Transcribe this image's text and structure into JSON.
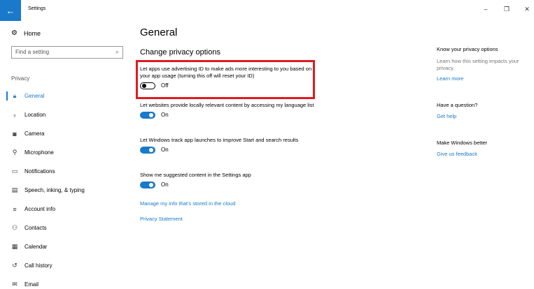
{
  "window": {
    "title": "Settings",
    "back_glyph": "←",
    "minimize_glyph": "–",
    "maximize_glyph": "❐",
    "close_glyph": "✕",
    "accent_color": "#1979ca",
    "highlight_color": "#e11b22"
  },
  "sidebar": {
    "home_label": "Home",
    "search_placeholder": "Find a setting",
    "section_label": "Privacy",
    "items": [
      {
        "label": "General",
        "icon": "lock-icon",
        "active": true
      },
      {
        "label": "Location",
        "icon": "location-icon"
      },
      {
        "label": "Camera",
        "icon": "camera-icon"
      },
      {
        "label": "Microphone",
        "icon": "microphone-icon"
      },
      {
        "label": "Notifications",
        "icon": "notifications-icon"
      },
      {
        "label": "Speech, inking, & typing",
        "icon": "speech-icon"
      },
      {
        "label": "Account info",
        "icon": "account-info-icon"
      },
      {
        "label": "Contacts",
        "icon": "contacts-icon"
      },
      {
        "label": "Calendar",
        "icon": "calendar-icon"
      },
      {
        "label": "Call history",
        "icon": "call-history-icon"
      },
      {
        "label": "Email",
        "icon": "email-icon"
      }
    ]
  },
  "main": {
    "title": "General",
    "subtitle": "Change privacy options",
    "settings": [
      {
        "text": "Let apps use advertising ID to make ads more interesting to you based on your app usage (turning this off will reset your ID)",
        "state": "Off"
      },
      {
        "text": "Let websites provide locally relevant content by accessing my language list",
        "state": "On"
      },
      {
        "text": "Let Windows track app launches to improve Start and search results",
        "state": "On"
      },
      {
        "text": "Show me suggested content in the Settings app",
        "state": "On"
      }
    ],
    "manage_link": "Manage my info that's stored in the cloud",
    "privacy_link": "Privacy Statement"
  },
  "right": {
    "know_head": "Know your privacy options",
    "know_text": "Learn how this setting impacts your privacy.",
    "learn_more": "Learn more",
    "question_head": "Have a question?",
    "get_help": "Get help",
    "better_head": "Make Windows better",
    "feedback": "Give us feedback"
  }
}
